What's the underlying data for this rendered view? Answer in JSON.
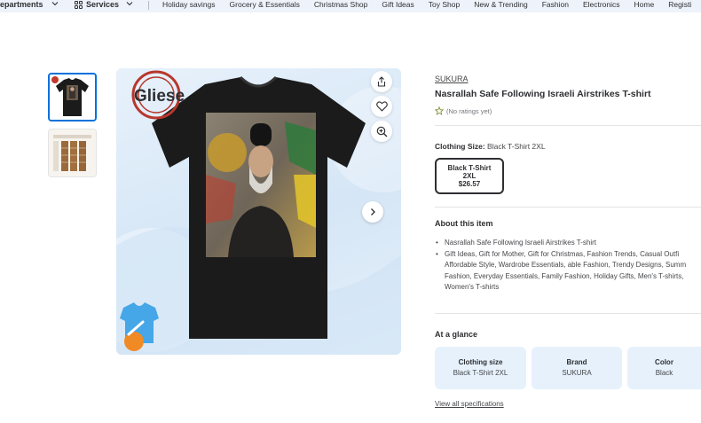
{
  "nav": {
    "departments": "epartments",
    "services": "Services",
    "links": [
      "Holiday savings",
      "Grocery & Essentials",
      "Christmas Shop",
      "Gift Ideas",
      "Toy Shop",
      "New & Trending",
      "Fashion",
      "Electronics",
      "Home",
      "Registi"
    ]
  },
  "gallery": {
    "watermark": "Gliese"
  },
  "product": {
    "brand": "SUKURA",
    "title": "Nasrallah Safe Following Israeli Airstrikes T-shirt",
    "rating_text": "(No ratings yet)",
    "size_label": "Clothing Size:",
    "size_value": "Black T-Shirt 2XL",
    "option": {
      "line1": "Black T-Shirt",
      "line2": "2XL",
      "price": "$26.57"
    }
  },
  "about": {
    "heading": "About this item",
    "items": [
      "Nasrallah Safe Following Israeli Airstrikes T-shirt",
      "Gift Ideas, Gift for Mother, Gift for Christmas, Fashion Trends, Casual Outfi Affordable Style, Wardrobe Essentials, able Fashion, Trendy Designs, Summ Fashion, Everyday Essentials, Family Fashion, Holiday Gifts, Men's T-shirts, Women's T-shirts"
    ]
  },
  "glance": {
    "heading": "At a glance",
    "cards": [
      {
        "label": "Clothing size",
        "value": "Black T-Shirt 2XL"
      },
      {
        "label": "Brand",
        "value": "SUKURA"
      },
      {
        "label": "Color",
        "value": "Black"
      }
    ],
    "link": "View all specifications"
  },
  "colors": {
    "accent": "#0071dc",
    "text": "#2e2f32",
    "card_bg": "#e6f1fc",
    "shirt": "#1b1b1b"
  }
}
